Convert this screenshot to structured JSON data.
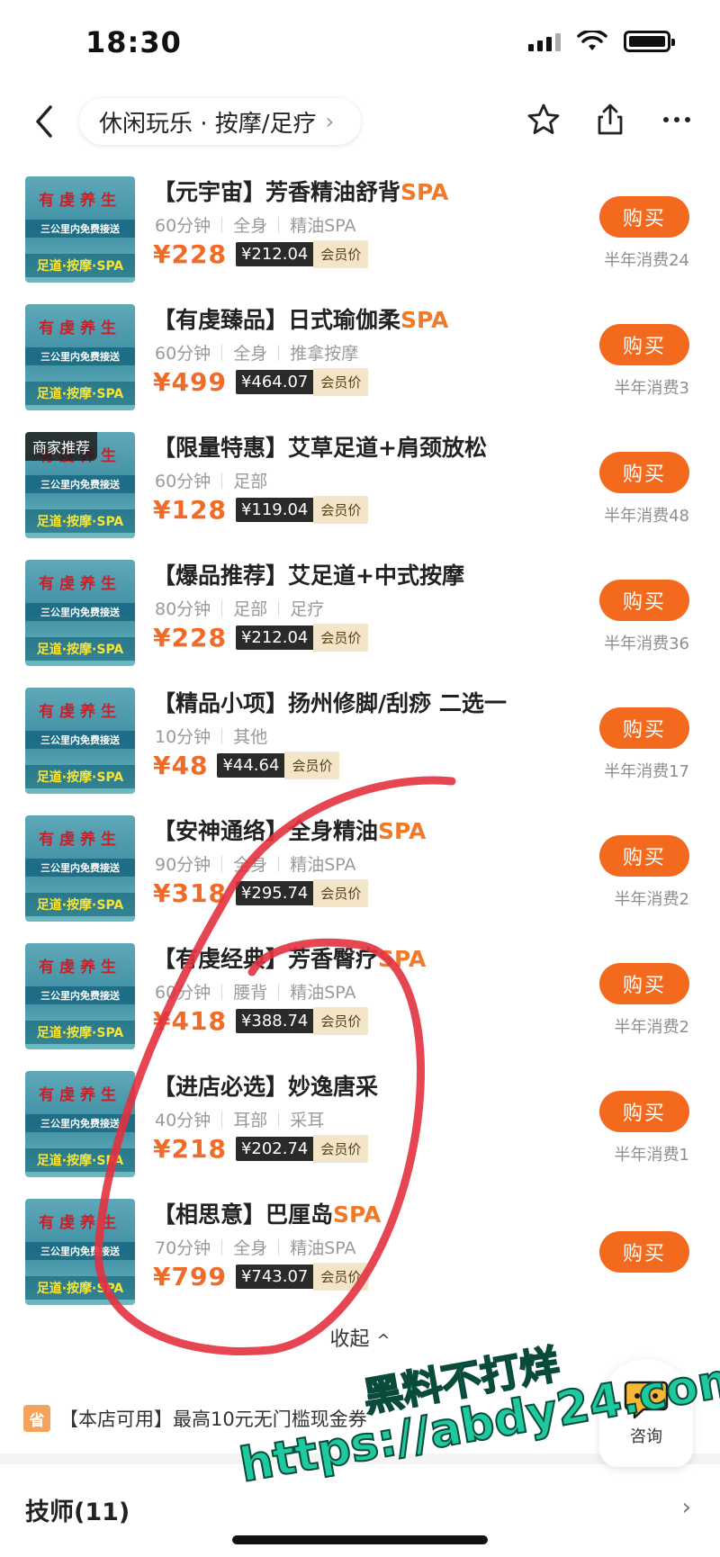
{
  "status_bar": {
    "time": "18:30"
  },
  "nav": {
    "breadcrumb": "休闲玩乐 · 按摩/足疗",
    "breadcrumb_chevron": "›"
  },
  "products": [
    {
      "title_prefix": "【元宇宙】芳香精油舒背",
      "title_spa": "SPA",
      "duration": "60分钟",
      "tags": [
        "全身",
        "精油SPA"
      ],
      "price": "¥228",
      "member_price": "¥212.04",
      "member_label": "会员价",
      "buy_label": "购买",
      "sales": "半年消费24",
      "badge": ""
    },
    {
      "title_prefix": "【有虔臻品】日式瑜伽柔",
      "title_spa": "SPA",
      "duration": "60分钟",
      "tags": [
        "全身",
        "推拿按摩"
      ],
      "price": "¥499",
      "member_price": "¥464.07",
      "member_label": "会员价",
      "buy_label": "购买",
      "sales": "半年消费3",
      "badge": ""
    },
    {
      "title_prefix": "【限量特惠】艾草足道+肩颈放松",
      "title_spa": "",
      "duration": "60分钟",
      "tags": [
        "足部"
      ],
      "price": "¥128",
      "member_price": "¥119.04",
      "member_label": "会员价",
      "buy_label": "购买",
      "sales": "半年消费48",
      "badge": "商家推荐"
    },
    {
      "title_prefix": "【爆品推荐】艾足道+中式按摩",
      "title_spa": "",
      "duration": "80分钟",
      "tags": [
        "足部",
        "足疗"
      ],
      "price": "¥228",
      "member_price": "¥212.04",
      "member_label": "会员价",
      "buy_label": "购买",
      "sales": "半年消费36",
      "badge": ""
    },
    {
      "title_prefix": "【精品小项】扬州修脚/刮痧 二选一",
      "title_spa": "",
      "duration": "10分钟",
      "tags": [
        "其他"
      ],
      "price": "¥48",
      "member_price": "¥44.64",
      "member_label": "会员价",
      "buy_label": "购买",
      "sales": "半年消费17",
      "badge": ""
    },
    {
      "title_prefix": "【安神通络】全身精油",
      "title_spa": "SPA",
      "duration": "90分钟",
      "tags": [
        "全身",
        "精油SPA"
      ],
      "price": "¥318",
      "member_price": "¥295.74",
      "member_label": "会员价",
      "buy_label": "购买",
      "sales": "半年消费2",
      "badge": ""
    },
    {
      "title_prefix": "【有虔经典】芳香臀疗",
      "title_spa": "SPA",
      "duration": "60分钟",
      "tags": [
        "腰背",
        "精油SPA"
      ],
      "price": "¥418",
      "member_price": "¥388.74",
      "member_label": "会员价",
      "buy_label": "购买",
      "sales": "半年消费2",
      "badge": ""
    },
    {
      "title_prefix": "【进店必选】妙逸唐采",
      "title_spa": "",
      "duration": "40分钟",
      "tags": [
        "耳部",
        "采耳"
      ],
      "price": "¥218",
      "member_price": "¥202.74",
      "member_label": "会员价",
      "buy_label": "购买",
      "sales": "半年消费1",
      "badge": ""
    },
    {
      "title_prefix": "【相思意】巴厘岛",
      "title_spa": "SPA",
      "duration": "70分钟",
      "tags": [
        "全身",
        "精油SPA"
      ],
      "price": "¥799",
      "member_price": "¥743.07",
      "member_label": "会员价",
      "buy_label": "购买",
      "sales": "",
      "badge": ""
    }
  ],
  "thumb": {
    "line1": "有虔养生",
    "line2": "三公里内免费接送",
    "line3": "足道·按摩·SPA"
  },
  "collapse": {
    "label": "收起",
    "chevron": "^"
  },
  "promo": {
    "icon_text": "省",
    "text": "【本店可用】最高10元无门槛现金券"
  },
  "chat": {
    "label": "咨询"
  },
  "technicians": {
    "label": "技师(11)",
    "chevron": "›"
  },
  "watermark": {
    "line1": "黑料不打烊",
    "line2": "https://abdy24.com"
  },
  "colors": {
    "accent": "#f36a1e",
    "price": "#f06a28",
    "member_bg": "#2a2a2a",
    "member_label_bg": "#f3e5c8",
    "annotation": "#e3313f"
  }
}
